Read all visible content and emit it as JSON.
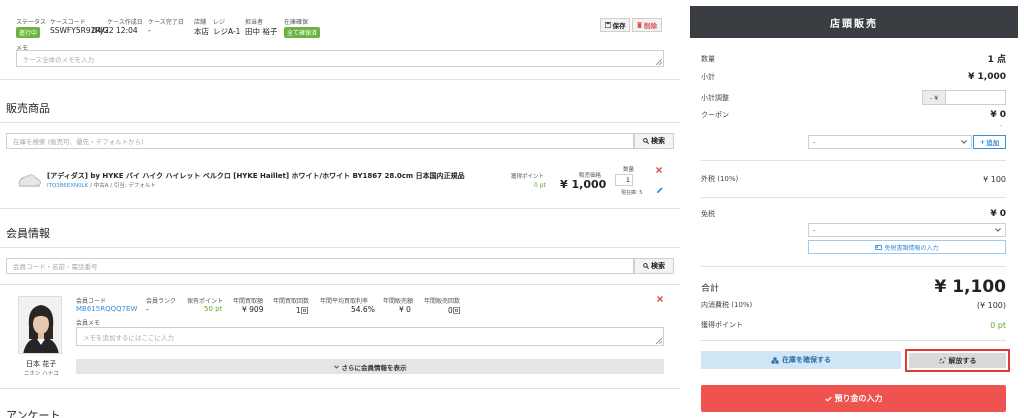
{
  "case": {
    "status_label": "ステータス",
    "status_value": "進行中",
    "code_label": "ケースコード",
    "code_value": "SSWFY5R92RJG",
    "created_label": "ケース作成日",
    "created_value": "04/22 12:04",
    "completed_label": "ケース完了日",
    "completed_value": "-",
    "store_label": "店舗",
    "store_value": "本店",
    "register_label": "レジ",
    "register_value": "レジA-1",
    "staff_label": "担当者",
    "staff_value": "田中 裕子",
    "stock_label": "在庫確保",
    "stock_value": "全て確保済",
    "save_label": "保存",
    "delete_label": "削除",
    "memo_label": "メモ",
    "memo_placeholder": "ケース全体のメモを入力"
  },
  "products": {
    "title": "販売商品",
    "search_placeholder": "在庫を検索 (販売可、優先・デフォルトから)",
    "search_button": "検索",
    "item": {
      "name": "[アディダス] by HYKE バイ ハイク ハイレット ベルクロ [HYKE Haillet] ホワイト/ホワイト BY1867 28.0cm 日本国内正規品",
      "sku": "ITQ386EXN0LK",
      "meta": " / 中古A / 引当: デフォルト",
      "points_label": "獲得ポイント",
      "points_value": "0 pt",
      "price_label": "販売価格",
      "price_value": "¥ 1,000",
      "qty_label": "数量",
      "qty_value": "1",
      "stock_text": "現在庫: 5"
    }
  },
  "member": {
    "title": "会員情報",
    "search_placeholder": "会員コード・名前・電話番号",
    "search_button": "検索",
    "name": "日本 花子",
    "kana": "ニホン ハナコ",
    "code_label": "会員コード",
    "code_value": "MB615RQQQ7EW",
    "rank_label": "会員ランク",
    "rank_value": "-",
    "points_label": "保有ポイント",
    "points_value": "50 pt",
    "annual_buy_label": "年間買取額",
    "annual_buy_value": "¥ 909",
    "annual_buy_count_label": "年間買取回数",
    "annual_buy_count_value": "1回",
    "avg_rate_label": "年間平均買取利率",
    "avg_rate_value": "54.6%",
    "annual_sale_label": "年間販売額",
    "annual_sale_value": "¥ 0",
    "annual_sale_count_label": "年間販売回数",
    "annual_sale_count_value": "0回",
    "memo_label": "会員メモ",
    "memo_placeholder": "メモを追加するにはここに入力",
    "more_button": "さらに会員情報を表示"
  },
  "survey": {
    "title": "アンケート"
  },
  "panel": {
    "title": "店頭販売",
    "qty_label": "数量",
    "qty_value": "1 点",
    "subtotal_label": "小計",
    "subtotal_value": "¥ 1,000",
    "adjust_label": "小計調整",
    "adjust_prefix": "- ¥",
    "coupon_label": "クーポン",
    "coupon_value": "¥ 0",
    "coupon_sub": "-",
    "coupon_select": "-",
    "coupon_add": "追加",
    "ext_tax_label": "外税 (10%)",
    "ext_tax_value": "¥ 100",
    "exempt_label": "免税",
    "exempt_value": "¥ 0",
    "exempt_select": "-",
    "exempt_doc_button": "免税書類情報の入力",
    "total_label": "合計",
    "total_value": "¥ 1,100",
    "incl_tax_label": "内消費税 (10%)",
    "incl_tax_value": "(¥ 100)",
    "earn_points_label": "獲得ポイント",
    "earn_points_value": "0 pt",
    "secure_button": "在庫を確保する",
    "release_button": "解放する",
    "deposit_button": "預り金の入力"
  }
}
